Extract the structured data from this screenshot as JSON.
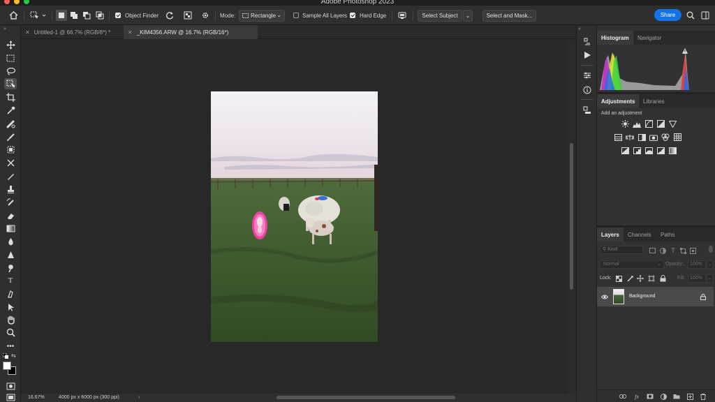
{
  "app": {
    "title": "Adobe Photoshop 2023"
  },
  "options_bar": {
    "object_finder_label": "Object Finder",
    "mode_label": "Mode:",
    "mode_value": "Rectangle",
    "sample_all_layers_label": "Sample All Layers",
    "sample_all_layers_checked": false,
    "hard_edge_label": "Hard Edge",
    "hard_edge_checked": true,
    "object_finder_checked": true,
    "select_subject_label": "Select Subject",
    "select_and_mask_label": "Select and Mask...",
    "share_label": "Share"
  },
  "tabs": [
    {
      "label": "Untitled-1 @ 66.7% (RGB/8*) *",
      "active": false
    },
    {
      "label": "_KIM4356.ARW @ 16.7% (RGB/16*)",
      "active": true
    }
  ],
  "tools": [
    "move-tool",
    "rectangular-marquee-tool",
    "lasso-tool",
    "object-selection-tool",
    "crop-tool",
    "eyedropper-tool",
    "spot-healing-brush-tool",
    "brush-tool",
    "clone-stamp-tool",
    "history-brush-tool",
    "content-aware-move-tool",
    "pencil-tool",
    "stamp-tool",
    "eraser-tool",
    "gradient-tool",
    "blur-tool",
    "sharpen-tool",
    "dodge-tool",
    "type-tool",
    "pen-tool",
    "path-selection-tool",
    "hand-tool",
    "zoom-tool",
    "more-tools"
  ],
  "status_bar": {
    "zoom": "16.67%",
    "doc_info": "4000 px x 6000 px (300 ppi)"
  },
  "histogram_panel": {
    "tabs": [
      "Histogram",
      "Navigator"
    ]
  },
  "adjustments_panel": {
    "tabs": [
      "Adjustments",
      "Libraries"
    ],
    "hint": "Add an adjustment"
  },
  "layers_panel": {
    "tabs": [
      "Layers",
      "Channels",
      "Paths"
    ],
    "filter_placeholder": "Kind",
    "blend_mode": "Normal",
    "opacity_label": "Opacity:",
    "opacity_value": "100%",
    "lock_label": "Lock:",
    "fill_label": "Fill:",
    "fill_value": "100%",
    "layers": [
      {
        "name": "Background",
        "visible": true,
        "locked": true
      }
    ]
  },
  "colors": {
    "accent": "#1473e6",
    "selection_highlight": "#ff3fae"
  }
}
